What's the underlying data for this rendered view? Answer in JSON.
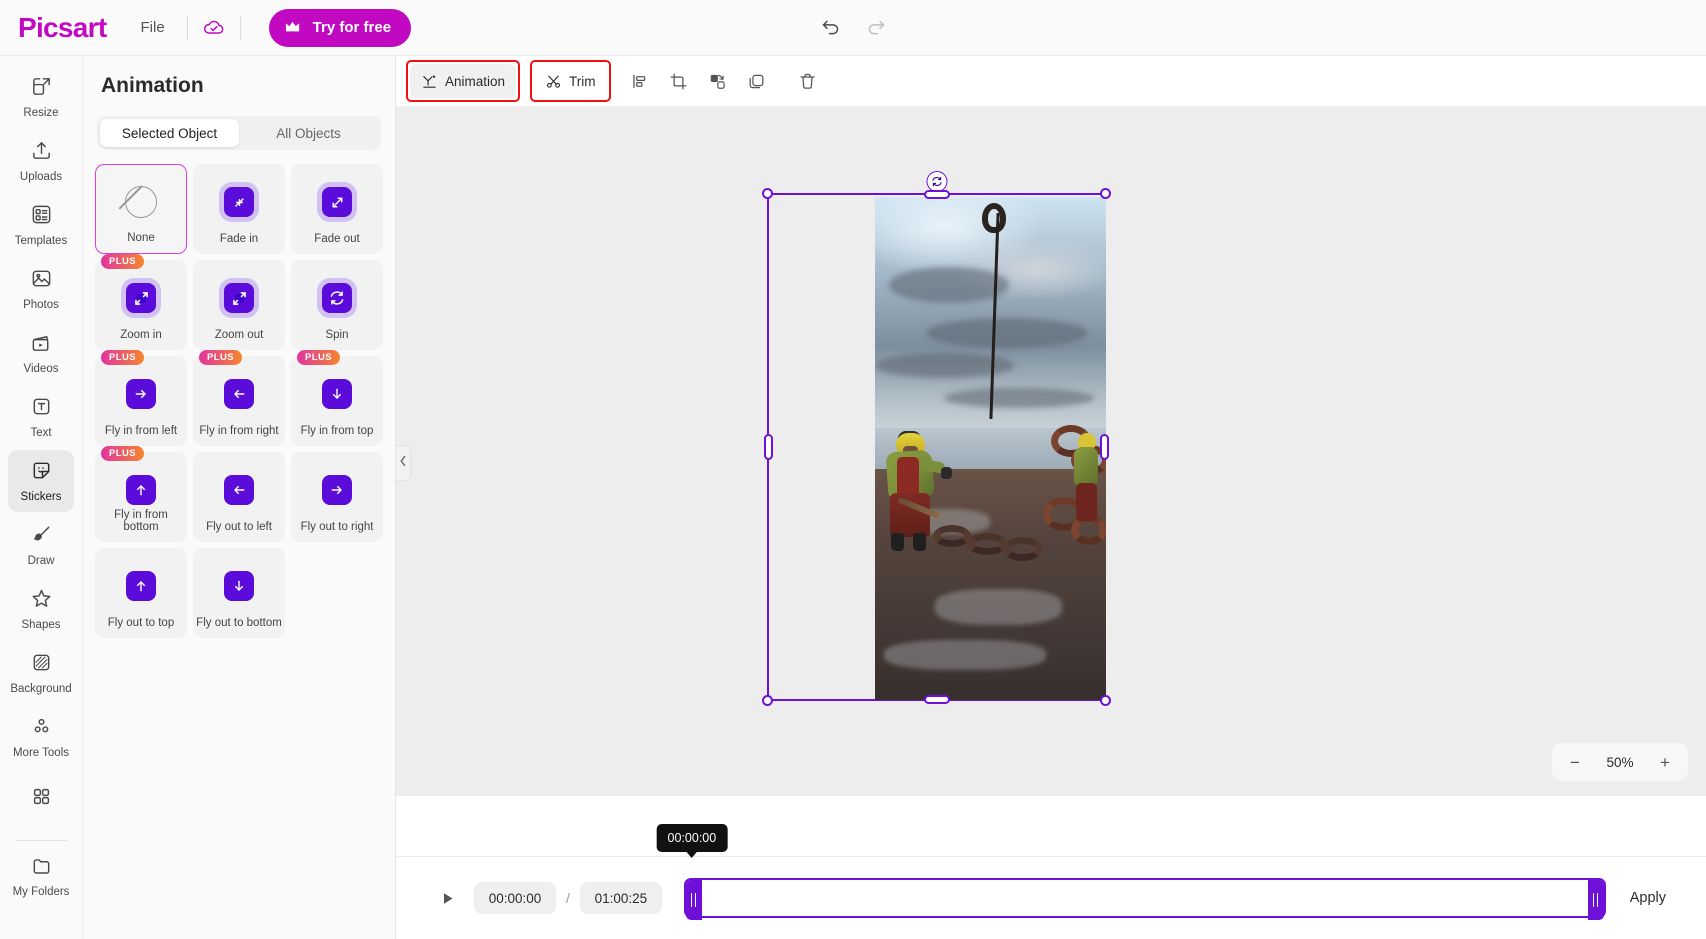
{
  "topbar": {
    "logo": "Picsart",
    "file_label": "File",
    "cloud_icon": "cloud-check-icon",
    "try_free_label": "Try for free",
    "crown_icon": "crown-icon",
    "undo_icon": "undo-icon",
    "redo_icon": "redo-icon"
  },
  "rail": {
    "items": [
      {
        "label": "Resize",
        "icon": "resize-icon",
        "active": false
      },
      {
        "label": "Uploads",
        "icon": "upload-icon",
        "active": false
      },
      {
        "label": "Templates",
        "icon": "templates-icon",
        "active": false
      },
      {
        "label": "Photos",
        "icon": "photo-icon",
        "active": false
      },
      {
        "label": "Videos",
        "icon": "video-icon",
        "active": false
      },
      {
        "label": "Text",
        "icon": "text-icon",
        "active": false
      },
      {
        "label": "Stickers",
        "icon": "sticker-icon",
        "active": true
      },
      {
        "label": "Draw",
        "icon": "brush-icon",
        "active": false
      },
      {
        "label": "Shapes",
        "icon": "star-icon",
        "active": false
      },
      {
        "label": "Background",
        "icon": "background-icon",
        "active": false
      },
      {
        "label": "More Tools",
        "icon": "more-tools-icon",
        "active": false
      },
      {
        "label": "",
        "icon": "apps-grid-icon",
        "active": false
      },
      {
        "label": "My Folders",
        "icon": "folder-icon",
        "active": false
      }
    ]
  },
  "panel": {
    "title": "Animation",
    "tabs": [
      {
        "label": "Selected Object",
        "active": true
      },
      {
        "label": "All Objects",
        "active": false
      }
    ],
    "collapse_icon": "chevron-left-icon",
    "animations": [
      {
        "label": "None",
        "icon": "none-icon",
        "plus": false,
        "selected": true,
        "halo": false
      },
      {
        "label": "Fade in",
        "icon": "arrows-in-icon",
        "plus": false,
        "selected": false,
        "halo": true
      },
      {
        "label": "Fade out",
        "icon": "arrows-out-icon",
        "plus": false,
        "selected": false,
        "halo": true
      },
      {
        "label": "Zoom in",
        "icon": "zoom-in-icon",
        "plus": true,
        "selected": false,
        "halo": true
      },
      {
        "label": "Zoom out",
        "icon": "zoom-out-icon",
        "plus": false,
        "selected": false,
        "halo": true
      },
      {
        "label": "Spin",
        "icon": "spin-icon",
        "plus": false,
        "selected": false,
        "halo": true
      },
      {
        "label": "Fly in from left",
        "icon": "arrow-right-icon",
        "plus": true,
        "selected": false,
        "halo": false
      },
      {
        "label": "Fly in from right",
        "icon": "arrow-left-icon",
        "plus": true,
        "selected": false,
        "halo": false
      },
      {
        "label": "Fly in from top",
        "icon": "arrow-down-icon",
        "plus": true,
        "selected": false,
        "halo": false
      },
      {
        "label": "Fly in from bottom",
        "icon": "arrow-up-icon",
        "plus": true,
        "selected": false,
        "halo": false
      },
      {
        "label": "Fly out to left",
        "icon": "arrow-left-icon",
        "plus": false,
        "selected": false,
        "halo": false
      },
      {
        "label": "Fly out to right",
        "icon": "arrow-right-icon",
        "plus": false,
        "selected": false,
        "halo": false
      },
      {
        "label": "Fly out to top",
        "icon": "arrow-up-icon",
        "plus": false,
        "selected": false,
        "halo": false
      },
      {
        "label": "Fly out to bottom",
        "icon": "arrow-down-icon",
        "plus": false,
        "selected": false,
        "halo": false
      }
    ],
    "plus_badge_label": "PLUS"
  },
  "toolbar": {
    "animation_label": "Animation",
    "animation_icon": "animation-icon",
    "trim_label": "Trim",
    "trim_icon": "scissors-icon",
    "align_icon": "align-icon",
    "crop_icon": "crop-icon",
    "cutout_icon": "cutout-icon",
    "duplicate_icon": "duplicate-icon",
    "delete_icon": "trash-icon",
    "highlight_color": "#ef1010"
  },
  "canvas": {
    "rotate_icon": "rotate-icon",
    "selection_color": "#6f10d8",
    "zoom": {
      "minus_label": "−",
      "value": "50%",
      "plus_label": "+"
    }
  },
  "timeline": {
    "play_icon": "play-icon",
    "current_time": "00:00:00",
    "separator": "/",
    "total_time": "01:00:25",
    "playhead_tooltip": "00:00:00",
    "apply_label": "Apply",
    "track_color": "#6f10d8"
  }
}
